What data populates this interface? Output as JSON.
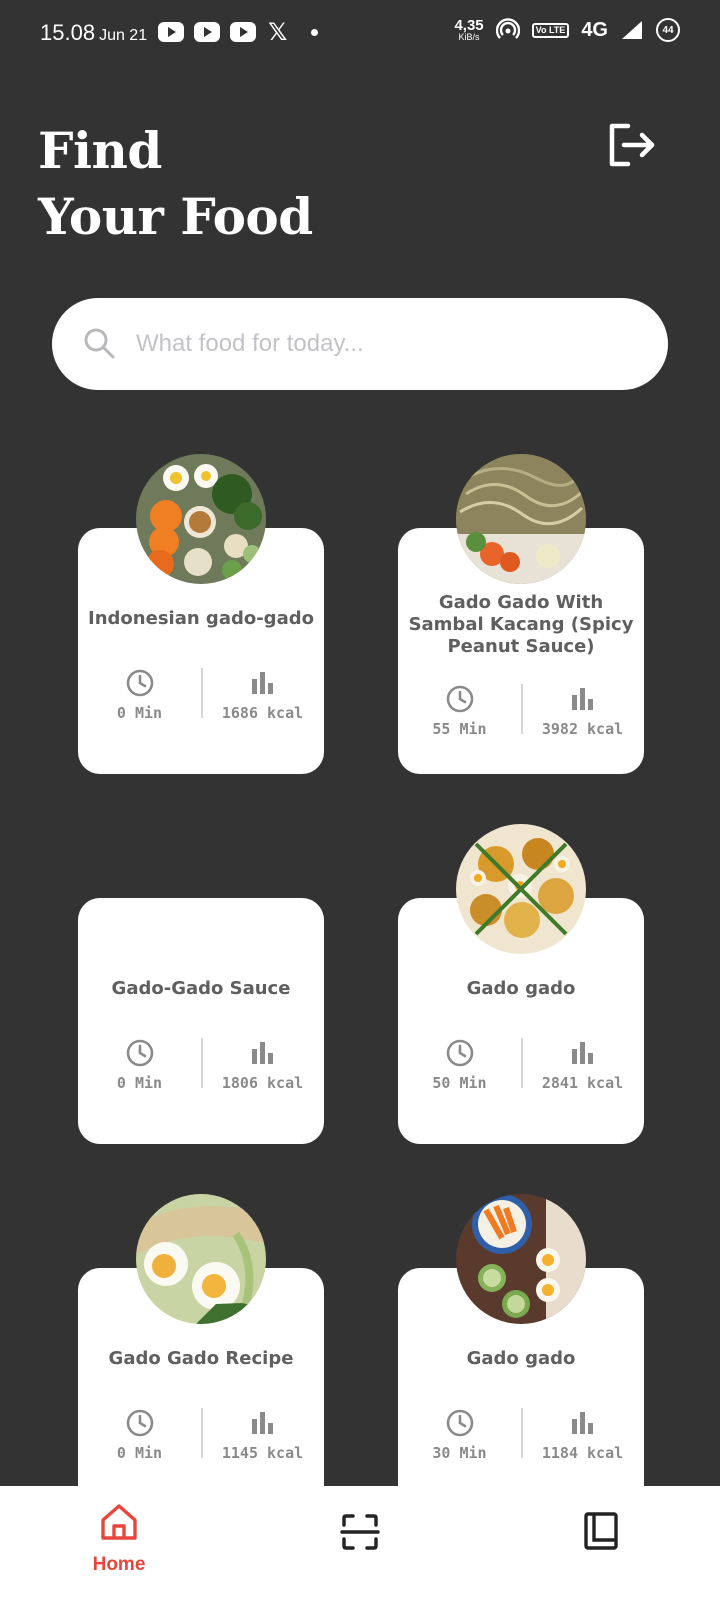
{
  "status_bar": {
    "time": "15.08",
    "date": "Jun 21",
    "net_speed": "4,35",
    "net_unit": "KiB/s",
    "volte": "Vo LTE",
    "network": "4G",
    "battery": "44"
  },
  "header": {
    "title_line1": "Find",
    "title_line2": "Your Food",
    "logout_icon": "logout-icon"
  },
  "search": {
    "placeholder": "What food for today...",
    "value": ""
  },
  "foods": [
    {
      "name": "Indonesian gado-gado",
      "time": "0 Min",
      "energy": "1686 kcal",
      "has_image": true
    },
    {
      "name": "Gado Gado With Sambal Kacang (Spicy Peanut Sauce)",
      "time": "55 Min",
      "energy": "3982 kcal",
      "has_image": true
    },
    {
      "name": "Gado-Gado Sauce",
      "time": "0 Min",
      "energy": "1806 kcal",
      "has_image": false
    },
    {
      "name": "Gado gado",
      "time": "50 Min",
      "energy": "2841 kcal",
      "has_image": true
    },
    {
      "name": "Gado Gado Recipe",
      "time": "0 Min",
      "energy": "1145 kcal",
      "has_image": true
    },
    {
      "name": "Gado gado",
      "time": "30 Min",
      "energy": "1184 kcal",
      "has_image": true
    }
  ],
  "bottom_nav": {
    "home_label": "Home",
    "active": "home",
    "accent_color": "#e8453c",
    "items": [
      "home-icon",
      "scan-icon",
      "book-icon"
    ]
  },
  "colors": {
    "background": "#333333",
    "card": "#ffffff",
    "stat_text": "#8a8a8a",
    "title_text": "#5f5f5f"
  }
}
